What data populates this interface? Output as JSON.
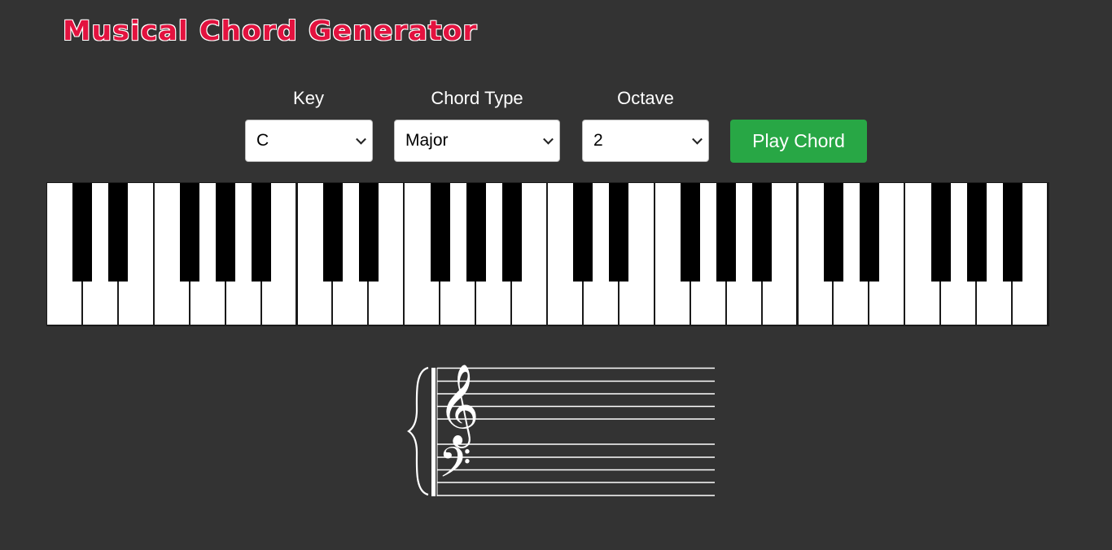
{
  "title": "Musical Chord Generator",
  "controls": {
    "key": {
      "label": "Key",
      "value": "C"
    },
    "chord_type": {
      "label": "Chord Type",
      "value": "Major"
    },
    "octave": {
      "label": "Octave",
      "value": "2"
    },
    "play_button": "Play Chord"
  },
  "piano": {
    "start_note": "C",
    "octaves": 4,
    "white_notes": [
      "C",
      "D",
      "E",
      "F",
      "G",
      "A",
      "B"
    ],
    "black_notes": [
      "C#",
      "D#",
      "F#",
      "G#",
      "A#"
    ],
    "highlighted_keys": []
  },
  "staff": {
    "clefs": [
      "treble-clef",
      "bass-clef"
    ],
    "notes": []
  },
  "colors": {
    "background": "#333333",
    "title": "#e3123f",
    "play_button": "#28a745"
  }
}
